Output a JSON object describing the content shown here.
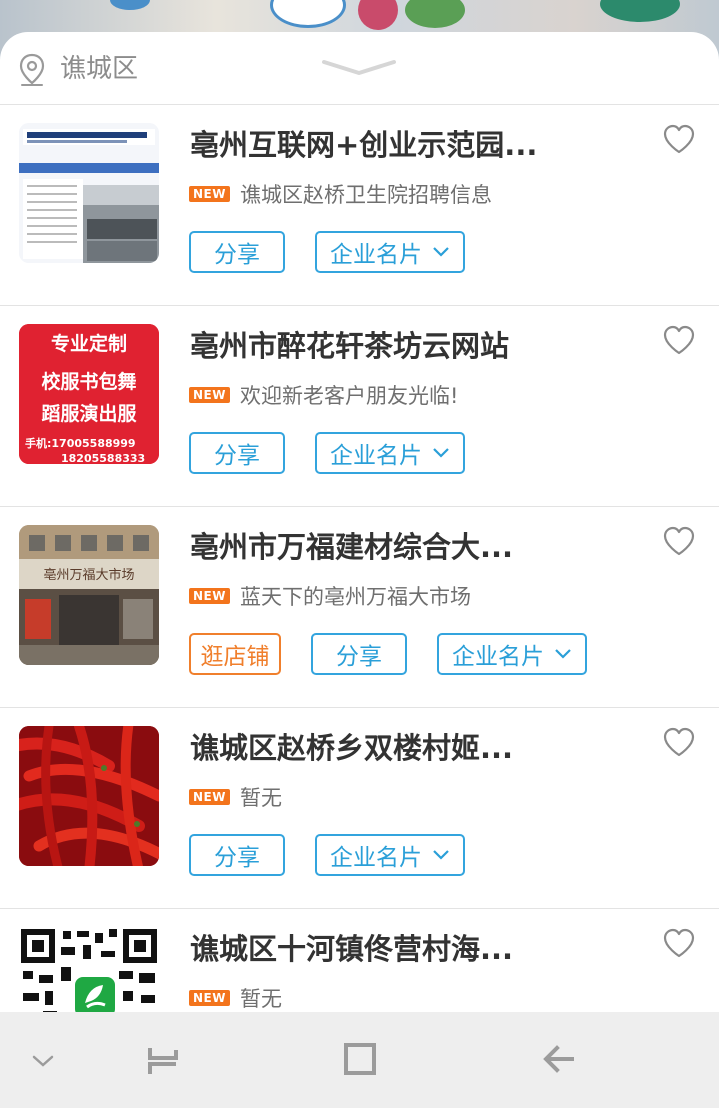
{
  "location": {
    "district": "谯城区"
  },
  "badge_label": "NEW",
  "buttons": {
    "share": "分享",
    "card": "企业名片",
    "shop": "逛店铺"
  },
  "thumbnails": {
    "item2_lines": [
      "专业定制",
      "校服书包舞",
      "蹈服演出服",
      "手机:17005588999",
      "18205588333"
    ],
    "item3_sign": "亳州万福大市场"
  },
  "items": [
    {
      "title": "亳州互联网+创业示范园...",
      "subtitle": "谯城区赵桥卫生院招聘信息",
      "has_shop": false
    },
    {
      "title": "亳州市醉花轩茶坊云网站",
      "subtitle": "欢迎新老客户朋友光临!",
      "has_shop": false
    },
    {
      "title": "亳州市万福建材综合大...",
      "subtitle": "蓝天下的亳州万福大市场",
      "has_shop": true
    },
    {
      "title": "谯城区赵桥乡双楼村姬...",
      "subtitle": "暂无",
      "has_shop": false
    },
    {
      "title": "谯城区十河镇佟营村海...",
      "subtitle": "暂无",
      "has_shop": false
    }
  ],
  "colors": {
    "accent_blue": "#33a4de",
    "accent_orange": "#f07f2c",
    "badge": "#f3741c"
  }
}
